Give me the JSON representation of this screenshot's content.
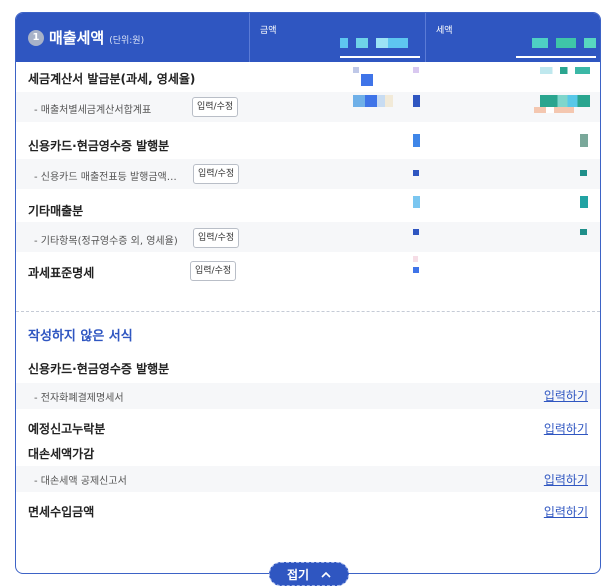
{
  "header": {
    "step_number": "1",
    "title": "매출세액",
    "unit": "(단위:원)",
    "col_amount": "금액",
    "col_tax": "세액"
  },
  "rows": {
    "tax_invoice": {
      "label": "세금계산서 발급분(과세, 영세율)"
    },
    "tax_invoice_sub": {
      "label": "- 매출처별세금계산서합계표",
      "button": "입력/수정"
    },
    "card_receipt": {
      "label": "신용카드·현금영수증 발행분"
    },
    "card_receipt_sub": {
      "label": "- 신용카드 매출전표등 발행금액…",
      "button": "입력/수정"
    },
    "other_sales": {
      "label": "기타매출분"
    },
    "other_sales_sub": {
      "label": "- 기타항목(정규영수증 외, 영세율)",
      "button": "입력/수정"
    },
    "tax_base": {
      "label": "과세표준명세",
      "button": "입력/수정"
    }
  },
  "unfilled": {
    "title": "작성하지 않은 서식",
    "card_receipt": {
      "label": "신용카드·현금영수증 발행분"
    },
    "e_payment": {
      "label": "- 전자화폐결제명세서",
      "link": "입력하기"
    },
    "omitted": {
      "label": "예정신고누락분",
      "link": "입력하기"
    },
    "bad_debt": {
      "label": "대손세액가감"
    },
    "bad_debt_sub": {
      "label": "- 대손세액 공제신고서",
      "link": "입력하기"
    },
    "exempt_income": {
      "label": "면세수입금액",
      "link": "입력하기"
    }
  },
  "footer": {
    "fold_label": "접기",
    "fold_icon": "chevron-up-icon"
  },
  "colors": {
    "header_bg": "#2f56c1",
    "accent": "#2f56c1"
  }
}
